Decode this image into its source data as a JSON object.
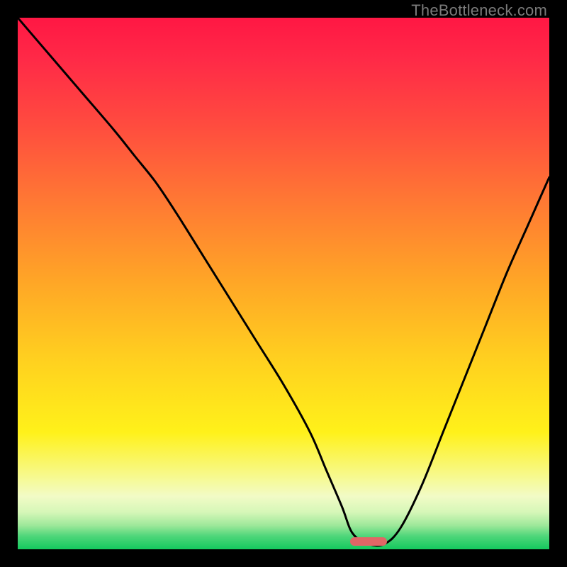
{
  "watermark": "TheBottleneck.com",
  "marker": {
    "color": "#e06666",
    "x_frac_start": 0.625,
    "x_frac_end": 0.695,
    "y_frac": 0.985
  },
  "gradient_stops": [
    {
      "offset": 0.0,
      "color": "#ff1744"
    },
    {
      "offset": 0.08,
      "color": "#ff2a47"
    },
    {
      "offset": 0.2,
      "color": "#ff4b3f"
    },
    {
      "offset": 0.35,
      "color": "#ff7a33"
    },
    {
      "offset": 0.5,
      "color": "#ffa726"
    },
    {
      "offset": 0.65,
      "color": "#ffd21f"
    },
    {
      "offset": 0.78,
      "color": "#fff11a"
    },
    {
      "offset": 0.86,
      "color": "#f7f98a"
    },
    {
      "offset": 0.9,
      "color": "#f2fbc6"
    },
    {
      "offset": 0.93,
      "color": "#d6f7b8"
    },
    {
      "offset": 0.955,
      "color": "#9ee89a"
    },
    {
      "offset": 0.975,
      "color": "#4fd67a"
    },
    {
      "offset": 1.0,
      "color": "#14c95e"
    }
  ],
  "chart_data": {
    "type": "line",
    "title": "",
    "xlabel": "",
    "ylabel": "",
    "xlim": [
      0,
      100
    ],
    "ylim": [
      0,
      100
    ],
    "grid": false,
    "legend": false,
    "series": [
      {
        "name": "bottleneck-curve",
        "x": [
          0,
          6,
          12,
          18,
          22,
          26,
          30,
          35,
          40,
          45,
          50,
          55,
          58,
          61,
          63,
          66,
          69,
          72,
          76,
          80,
          84,
          88,
          92,
          96,
          100
        ],
        "y": [
          100,
          93,
          86,
          79,
          74,
          69,
          63,
          55,
          47,
          39,
          31,
          22,
          15,
          8,
          3,
          1,
          1,
          4,
          12,
          22,
          32,
          42,
          52,
          61,
          70
        ]
      }
    ],
    "annotations": [
      {
        "type": "marker",
        "shape": "rounded-bar",
        "x_start": 62.5,
        "x_end": 69.5,
        "y": 1.5,
        "color": "#e06666"
      }
    ]
  }
}
